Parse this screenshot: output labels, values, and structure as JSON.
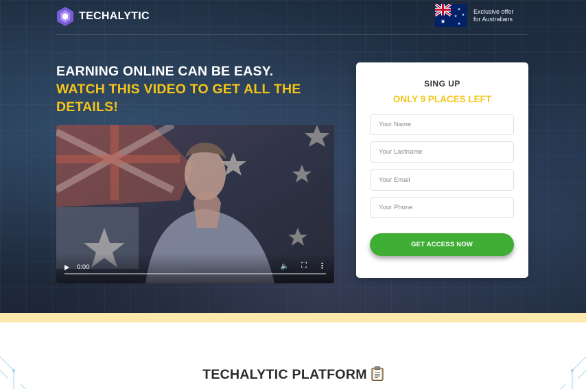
{
  "header": {
    "brand": "TECHALYTIC",
    "offer_line1": "Exclusive offer",
    "offer_line2": "for Australians",
    "logo_icon": "hexagon-logo-icon",
    "flag_icon": "australia-flag-icon"
  },
  "hero": {
    "headline_white": "EARNING ONLINE CAN BE EASY.",
    "headline_yellow": "WATCH THIS VIDEO TO GET ALL THE DETAILS!"
  },
  "video": {
    "current_time": "0:00",
    "progress": 0
  },
  "form": {
    "title": "SING UP",
    "subtitle": "ONLY 9 PLACES LEFT",
    "fields": [
      {
        "placeholder": "Your Name",
        "value": ""
      },
      {
        "placeholder": "Your Lastname",
        "value": ""
      },
      {
        "placeholder": "Your Email",
        "value": ""
      },
      {
        "placeholder": "Your Phone",
        "value": ""
      }
    ],
    "submit_label": "GET ACCESS NOW"
  },
  "platform": {
    "title": "TECHALYTIC PLATFORM",
    "icon": "clipboard-icon"
  },
  "colors": {
    "accent_yellow": "#f5c518",
    "button_green": "#3fae34",
    "band_cream": "#fbe9ae",
    "hero_dark": "#1f2d40"
  }
}
